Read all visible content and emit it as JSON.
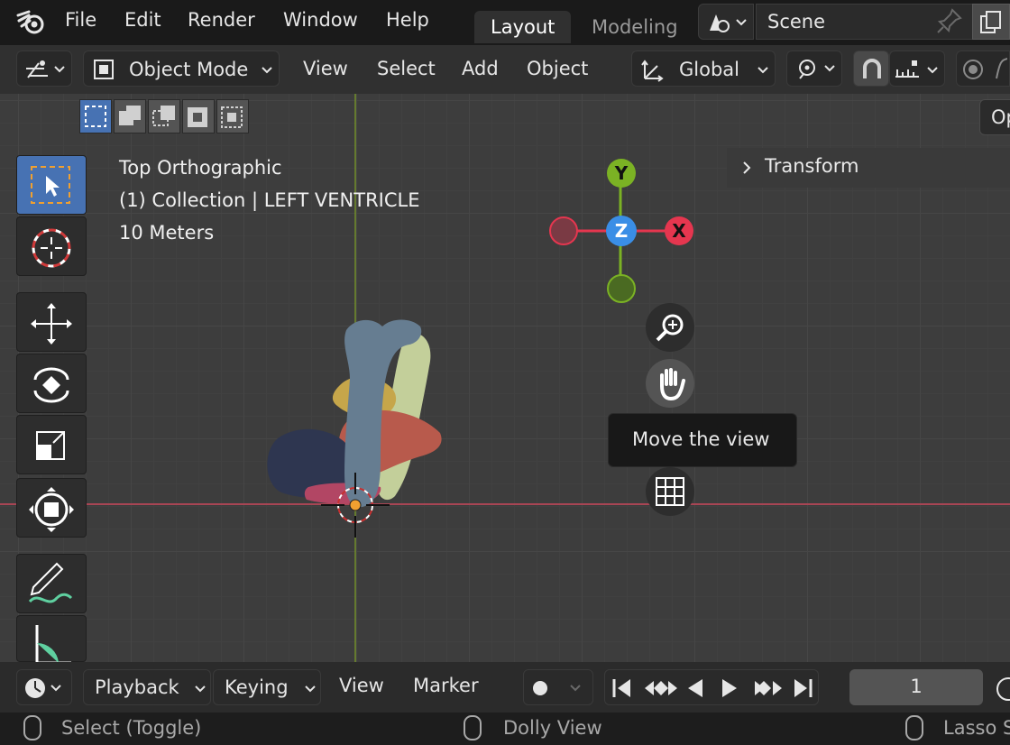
{
  "menubar": {
    "items": [
      "File",
      "Edit",
      "Render",
      "Window",
      "Help"
    ],
    "workspace_tabs": [
      {
        "label": "Layout",
        "active": true
      },
      {
        "label": "Modeling",
        "active": false
      }
    ],
    "scene_name": "Scene"
  },
  "header": {
    "mode": "Object Mode",
    "menus": [
      "View",
      "Select",
      "Add",
      "Object"
    ],
    "transform_orientation": "Global"
  },
  "viewport": {
    "view_name": "Top Orthographic",
    "collection_info": "(1) Collection | LEFT VENTRICLE",
    "scale_info": "10 Meters",
    "gizmo": {
      "x_label": "X",
      "y_label": "Y",
      "z_label": "Z"
    },
    "tooltip": "Move the view",
    "sidebar_panel": "Transform",
    "options_button": "Op"
  },
  "timeline": {
    "menus": [
      "Playback",
      "Keying",
      "View",
      "Marker"
    ],
    "current_frame": "1"
  },
  "statusbar": {
    "left": "Select (Toggle)",
    "middle": "Dolly View",
    "right": "Lasso S"
  },
  "colors": {
    "accent": "#4772b3",
    "axis_x": "#e5364f",
    "axis_y": "#7bb224",
    "axis_z": "#3a8ee6"
  }
}
